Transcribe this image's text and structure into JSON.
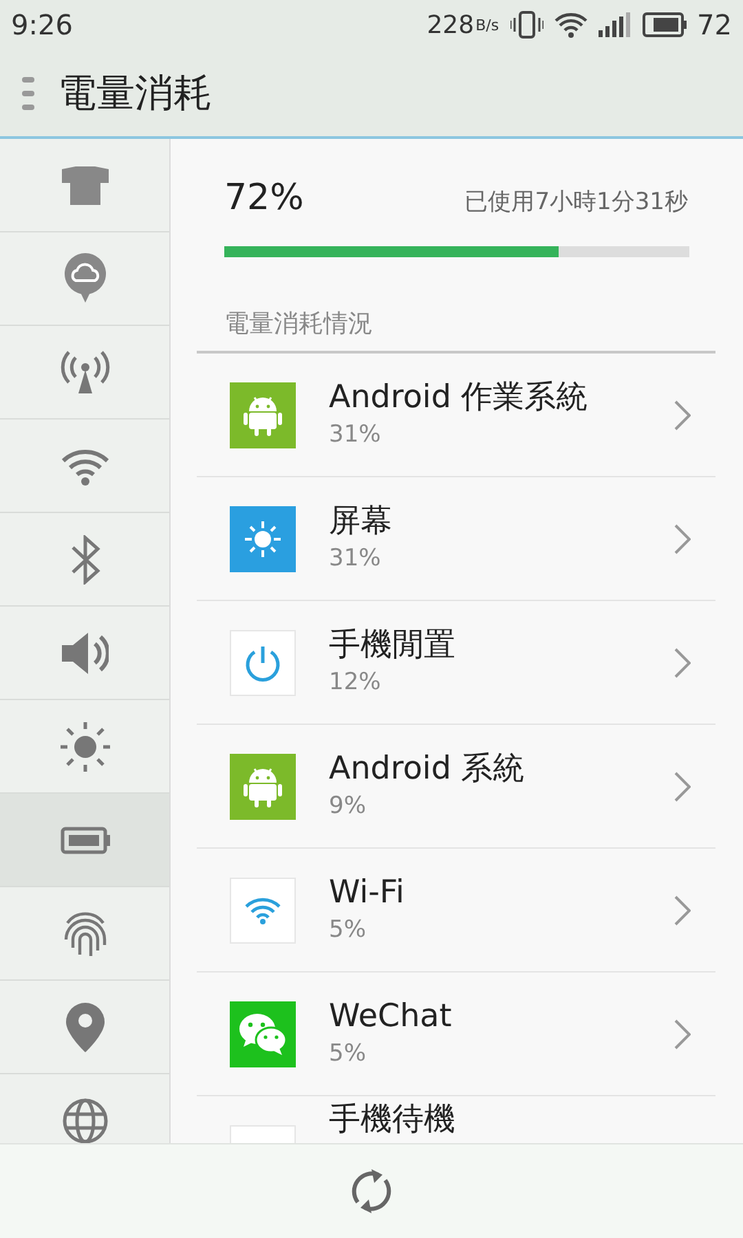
{
  "status_bar": {
    "time": "9:26",
    "speed": "228",
    "speed_unit": "B/s",
    "battery": "72"
  },
  "header": {
    "title": "電量消耗"
  },
  "sidebar": {
    "items": [
      {
        "selected": false
      },
      {
        "selected": false
      },
      {
        "selected": false
      },
      {
        "selected": false
      },
      {
        "selected": false
      },
      {
        "selected": false
      },
      {
        "selected": false
      },
      {
        "selected": true
      },
      {
        "selected": false
      },
      {
        "selected": false
      },
      {
        "selected": false
      }
    ]
  },
  "battery": {
    "percent": "72%",
    "used": "已使用7小時1分31秒",
    "level": 0.72
  },
  "section_title": "電量消耗情況",
  "apps": [
    {
      "name": "Android 作業系統",
      "percent": "31%"
    },
    {
      "name": "屏幕",
      "percent": "31%"
    },
    {
      "name": "手機閒置",
      "percent": "12%"
    },
    {
      "name": "Android 系統",
      "percent": "9%"
    },
    {
      "name": "Wi-Fi",
      "percent": "5%"
    },
    {
      "name": "WeChat",
      "percent": "5%"
    },
    {
      "name": "手機待機"
    }
  ]
}
